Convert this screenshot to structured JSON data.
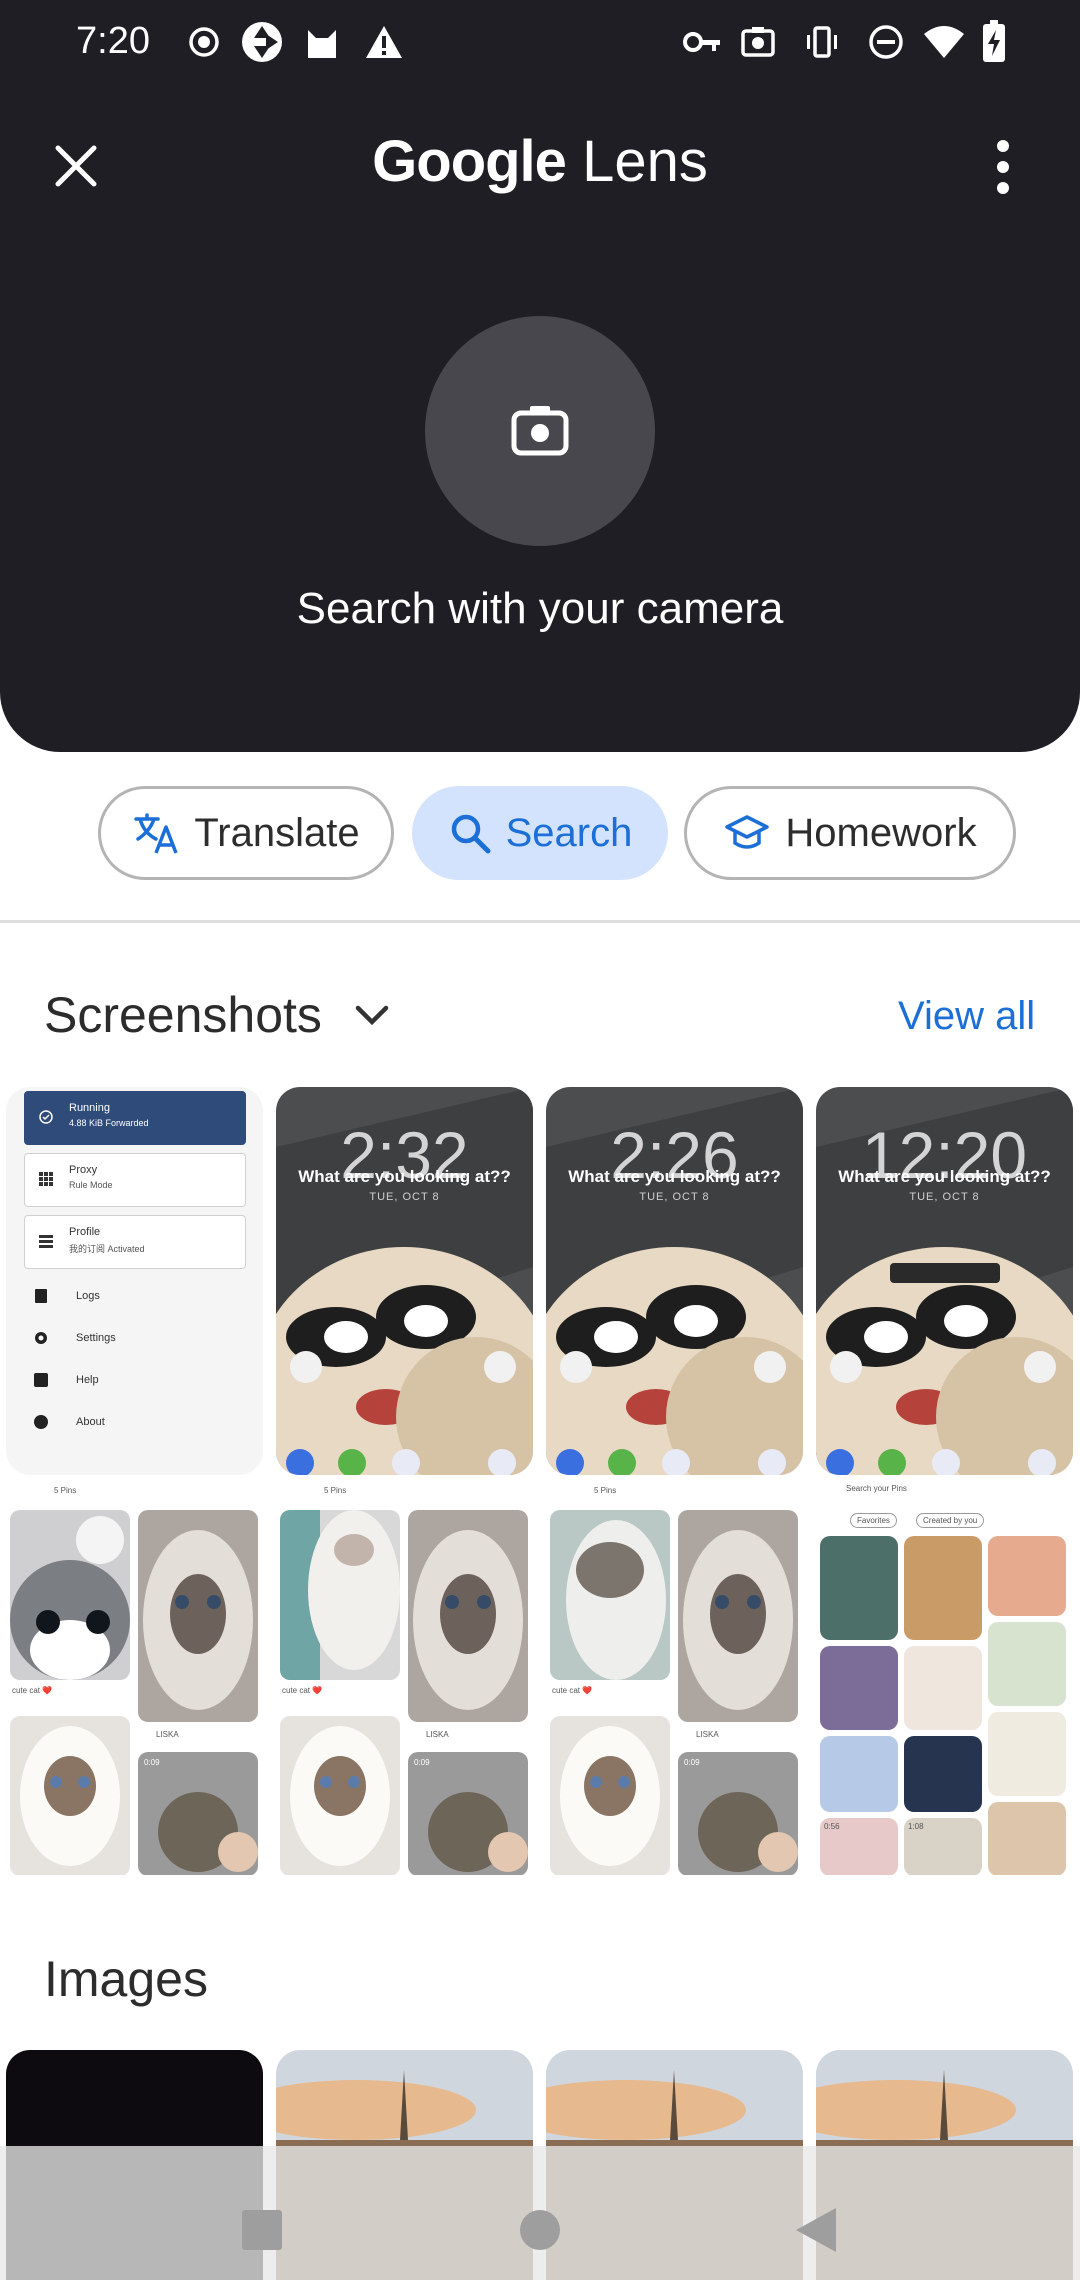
{
  "status_bar": {
    "time": "7:20",
    "left_icons": [
      "record-icon",
      "vpn-shutter-icon",
      "cat-app-icon",
      "warning-icon"
    ],
    "right_icons": [
      "key-icon",
      "screenshot-icon",
      "vibrate-icon",
      "dnd-icon",
      "wifi-icon",
      "battery-charging-icon"
    ]
  },
  "header": {
    "title_google": "Google",
    "title_lens": "Lens",
    "close_icon": "close-icon",
    "more_icon": "more-vert-icon"
  },
  "camera": {
    "caption": "Search with your camera",
    "icon": "camera-icon"
  },
  "modes": [
    {
      "label": "Translate",
      "icon": "translate-icon",
      "active": false
    },
    {
      "label": "Search",
      "icon": "search-icon",
      "active": true
    },
    {
      "label": "Homework",
      "icon": "graduation-cap-icon",
      "active": false
    }
  ],
  "screenshots": {
    "title": "Screenshots",
    "view_all": "View all",
    "vpn_app": {
      "running_title": "Running",
      "running_sub": "4.88 KiB Forwarded",
      "proxy_title": "Proxy",
      "proxy_sub": "Rule Mode",
      "profile_title": "Profile",
      "profile_sub": "我的订阅 Activated",
      "menu": [
        "Logs",
        "Settings",
        "Help",
        "About"
      ]
    },
    "lock_screens": [
      {
        "time": "2:32",
        "question": "What are you looking at??",
        "date": "TUE, OCT 8"
      },
      {
        "time": "2:26",
        "question": "What are you looking at??",
        "date": "TUE, OCT 8"
      },
      {
        "time": "12:20",
        "question": "What are you looking at??",
        "date": "TUE, OCT 8"
      }
    ],
    "pinterest": {
      "pins_label": "5 Pins",
      "caption": "cute cat ❤️",
      "user": "LISKA",
      "duration": "0:09",
      "search_placeholder": "Search your Pins",
      "filter_favorites": "Favorites",
      "filter_created": "Created by you",
      "clip_time_1": "0:56",
      "clip_time_2": "1:08"
    }
  },
  "images": {
    "title": "Images"
  },
  "nav_bar": {
    "recents_icon": "recents-square-icon",
    "home_icon": "home-circle-icon",
    "back_icon": "back-triangle-icon"
  },
  "colors": {
    "panel": "#1f1e24",
    "accent": "#1b6fd6",
    "chip_active_bg": "#d3e3fd"
  }
}
